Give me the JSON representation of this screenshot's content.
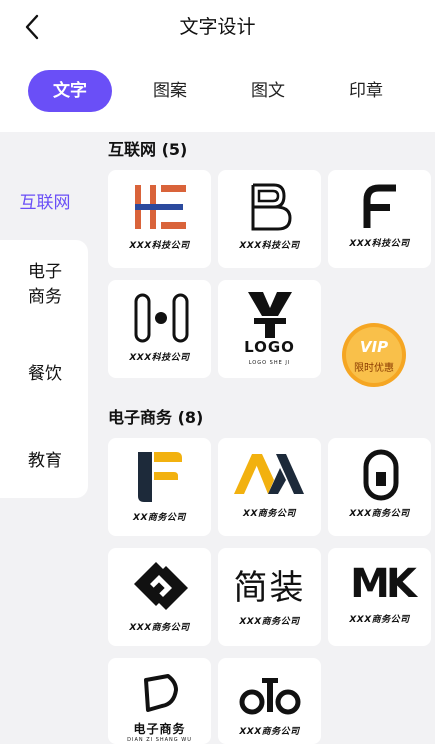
{
  "header": {
    "title": "文字设计",
    "tabs": [
      {
        "label": "文字",
        "active": true
      },
      {
        "label": "图案",
        "active": false
      },
      {
        "label": "图文",
        "active": false
      },
      {
        "label": "印章",
        "active": false
      }
    ]
  },
  "sidebar": {
    "items": [
      {
        "label": "互联网",
        "active": true
      },
      {
        "label": "电子\n商务",
        "active": false
      },
      {
        "label": "餐饮",
        "active": false
      },
      {
        "label": "教育",
        "active": false
      }
    ]
  },
  "sections": [
    {
      "title": "互联网 (5)",
      "cards": [
        {
          "caption": "XXX科技公司",
          "logo": "HE"
        },
        {
          "caption": "XXX科技公司",
          "logo": "B"
        },
        {
          "caption": "XXX科技公司",
          "logo": "F"
        },
        {
          "caption": "XXX科技公司",
          "logo": "pill-dot-pill"
        },
        {
          "caption": "LOGO",
          "subcaption": "LOGO SHE JI",
          "logo": "yen"
        }
      ]
    },
    {
      "title": "电子商务 (8)",
      "cards": [
        {
          "caption": "XX商务公司",
          "logo": "F-rounded"
        },
        {
          "caption": "XX商务公司",
          "logo": "M"
        },
        {
          "caption": "XXX商务公司",
          "logo": "O-bar"
        },
        {
          "caption": "XXX商务公司",
          "logo": "diamond-arrows"
        },
        {
          "caption": "XXX商务公司",
          "logo": "简装"
        },
        {
          "caption": "XXX商务公司",
          "logo": "MK"
        },
        {
          "caption": "电子商务",
          "subcaption": "DIAN ZI SHANG WU",
          "logo": "D-shape"
        },
        {
          "caption": "XXX商务公司",
          "logo": "oTo"
        }
      ]
    }
  ],
  "vip": {
    "label": "VIP",
    "sublabel": "限时优惠"
  },
  "colors": {
    "accent": "#6a4ff7",
    "he_orange": "#d9633a",
    "he_blue": "#2b4a9e",
    "m_yellow": "#f2b10f",
    "vip_gold": "#f5a623"
  }
}
